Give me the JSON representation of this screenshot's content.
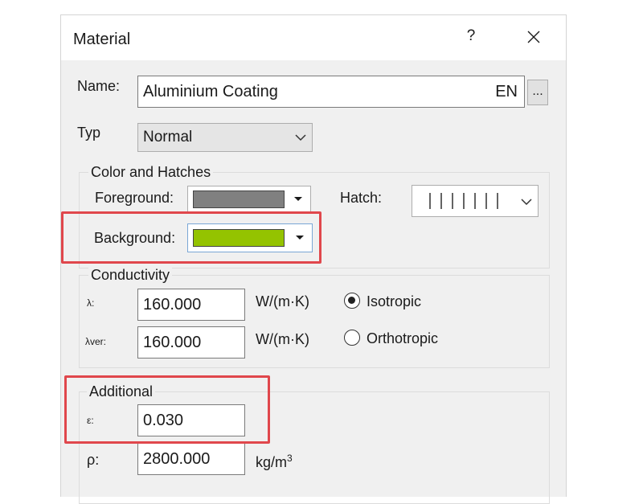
{
  "dialog": {
    "title": "Material",
    "help_label": "?",
    "close_label": "✕"
  },
  "name": {
    "label": "Name:",
    "value": "Aluminium Coating",
    "lang": "EN",
    "browse_label": "..."
  },
  "typ": {
    "label": "Typ",
    "value": "Normal"
  },
  "color_hatches": {
    "title": "Color and Hatches",
    "foreground_label": "Foreground:",
    "foreground_color": "#808080",
    "background_label": "Background:",
    "background_color": "#94c300",
    "hatch_label": "Hatch:"
  },
  "conductivity": {
    "title": "Conductivity",
    "lambda_label": "λ:",
    "lambda_value": "160.000",
    "lambda_unit": "W/(m·K)",
    "lambda_ver_label": "λver:",
    "lambda_ver_value": "160.000",
    "lambda_ver_unit": "W/(m·K)",
    "isotropic_label": "Isotropic",
    "orthotropic_label": "Orthotropic",
    "selected": "isotropic"
  },
  "additional": {
    "title": "Additional",
    "epsilon_label": "ε:",
    "epsilon_value": "0.030",
    "rho_label": "ρ:",
    "rho_value": "2800.000",
    "rho_unit": "kg/m"
  },
  "colors": {
    "highlight": "#e0474c"
  }
}
